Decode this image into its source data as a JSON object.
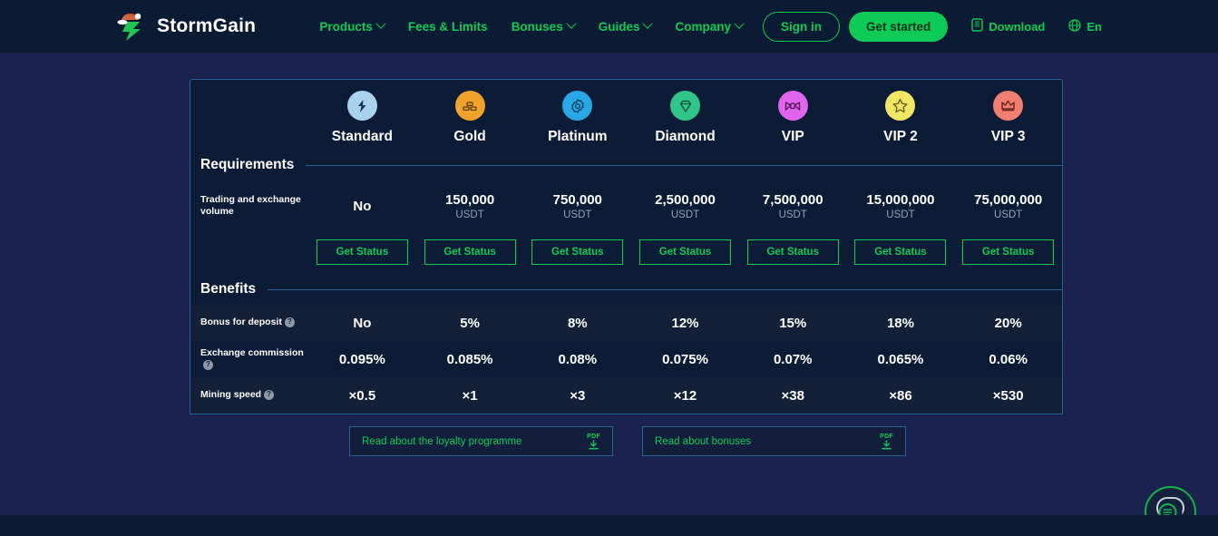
{
  "header": {
    "logo_text": "StormGain",
    "logo_icon": "stormgain-bolt-santa-logo",
    "nav": [
      {
        "label": "Products",
        "has_caret": true
      },
      {
        "label": "Fees & Limits",
        "has_caret": false
      },
      {
        "label": "Bonuses",
        "has_caret": true
      },
      {
        "label": "Guides",
        "has_caret": true
      },
      {
        "label": "Company",
        "has_caret": true
      }
    ],
    "sign_in_label": "Sign in",
    "get_started_label": "Get started",
    "download_label": "Download",
    "download_icon": "mobile-phone-icon",
    "language_label": "En",
    "language_icon": "globe-icon"
  },
  "colors": {
    "page_bg": "#1a2350",
    "header_bg": "#0b1b33",
    "card_bg": "#0c1c37",
    "row_alt_bg": "#122038",
    "border": "#2c5f91",
    "accent_green": "#0ecb58",
    "muted_text": "#8fa3bd"
  },
  "tiers": [
    {
      "name": "Standard",
      "icon": "lightning-bolt-icon",
      "circle_color": "#a9d1ee",
      "glyph_color": "#14335c"
    },
    {
      "name": "Gold",
      "icon": "gold-bars-icon",
      "circle_color": "#f0a32a",
      "glyph_color": "#5a3a06"
    },
    {
      "name": "Platinum",
      "icon": "platinum-badge-icon",
      "circle_color": "#29a8e8",
      "glyph_color": "#0d3e5e"
    },
    {
      "name": "Diamond",
      "icon": "diamond-icon",
      "circle_color": "#2fc48a",
      "glyph_color": "#0d4e36"
    },
    {
      "name": "VIP",
      "icon": "bowtie-icon",
      "circle_color": "#e065ec",
      "glyph_color": "#5c1a63"
    },
    {
      "name": "VIP 2",
      "icon": "star-icon",
      "circle_color": "#f2e765",
      "glyph_color": "#6b6413"
    },
    {
      "name": "VIP 3",
      "icon": "crown-icon",
      "circle_color": "#f07f72",
      "glyph_color": "#6b221a"
    }
  ],
  "requirements": {
    "section_title": "Requirements",
    "volume_row": {
      "label": "Trading and exchange volume",
      "unit": "USDT",
      "values": [
        "No",
        "150,000",
        "750,000",
        "2,500,000",
        "7,500,000",
        "15,000,000",
        "75,000,000"
      ],
      "has_unit": [
        false,
        true,
        true,
        true,
        true,
        true,
        true
      ]
    },
    "status_button_label": "Get Status",
    "status_buttons_count": 7
  },
  "benefits": {
    "section_title": "Benefits",
    "rows": [
      {
        "label": "Bonus for deposit",
        "has_help": true,
        "values": [
          "No",
          "5%",
          "8%",
          "12%",
          "15%",
          "18%",
          "20%"
        ]
      },
      {
        "label": "Exchange commission",
        "has_help": true,
        "values": [
          "0.095%",
          "0.085%",
          "0.08%",
          "0.075%",
          "0.07%",
          "0.065%",
          "0.06%"
        ]
      },
      {
        "label": "Mining speed",
        "has_help": true,
        "values": [
          "×0.5",
          "×1",
          "×3",
          "×12",
          "×38",
          "×86",
          "×530"
        ]
      }
    ],
    "help_glyph": "?"
  },
  "pdf_links": [
    {
      "label": "Read about the loyalty programme",
      "icon": "pdf-download-icon",
      "icon_text": "PDF"
    },
    {
      "label": "Read about bonuses",
      "icon": "pdf-download-icon",
      "icon_text": "PDF"
    }
  ],
  "chat_widget": {
    "icon": "chat-bubbles-icon"
  }
}
